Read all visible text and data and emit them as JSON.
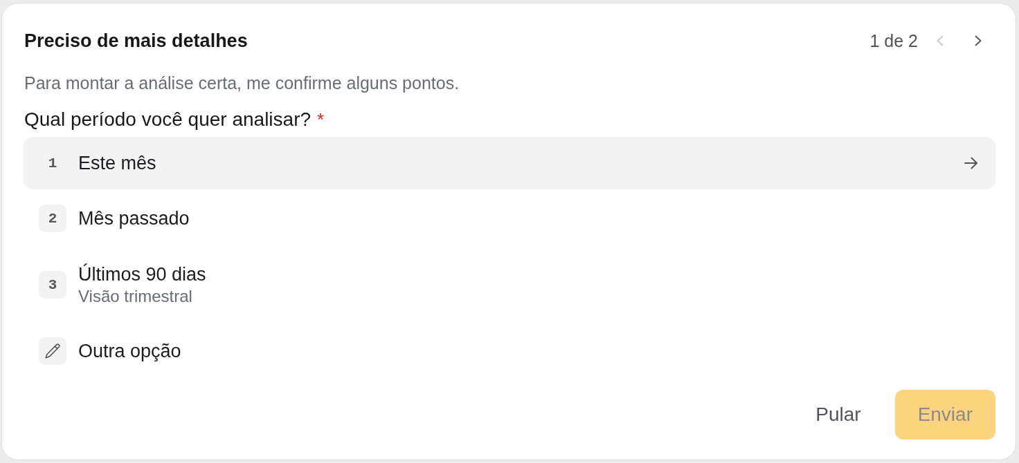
{
  "header": {
    "title": "Preciso de mais detalhes",
    "pager": {
      "text": "1 de 2",
      "prev": {
        "disabled": true
      },
      "next": {
        "disabled": false
      }
    }
  },
  "subtitle": "Para montar a análise certa, me confirme alguns pontos.",
  "question": {
    "text": "Qual período você quer analisar?",
    "required_mark": "*"
  },
  "options": [
    {
      "kind": "numbered",
      "number": "1",
      "label": "Este mês",
      "selected": true
    },
    {
      "kind": "numbered",
      "number": "2",
      "label": "Mês passado",
      "selected": false
    },
    {
      "kind": "numbered",
      "number": "3",
      "label": "Últimos 90 dias",
      "description": "Visão trimestral",
      "selected": false
    },
    {
      "kind": "custom",
      "label": "Outra opção",
      "selected": false
    }
  ],
  "actions": [
    {
      "kind": "text",
      "label": "Pular",
      "disabled": false
    },
    {
      "kind": "primary",
      "label": "Enviar",
      "disabled": true
    }
  ]
}
